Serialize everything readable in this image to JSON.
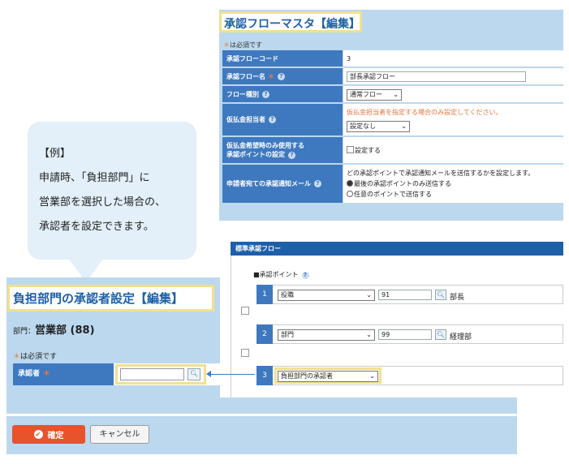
{
  "master": {
    "title": "承認フローマスタ【編集】",
    "required_note": "は必須です",
    "required_mark": "＊",
    "rows": {
      "code": {
        "label": "承認フローコード",
        "value": "3"
      },
      "name": {
        "label": "承認フロー名",
        "value": "部長承認フロー"
      },
      "type": {
        "label": "フロー種別",
        "value": "通常フロー"
      },
      "advance": {
        "label": "仮払金担当者",
        "note": "仮払金担当者を指定する場合のみ設定してください。",
        "value": "設定なし"
      },
      "advance_only": {
        "label_line1": "仮払金希望時のみ使用する",
        "label_line2": "承認ポイントの設定",
        "checkbox_label": "設定する"
      },
      "mail": {
        "label": "申請者宛ての承認通知メール",
        "desc": "どの承認ポイントで承認通知メールを送信するかを設定します。",
        "option1": "最後の承認ポイントのみ送信する",
        "option2": "任意のポイントで送信する"
      }
    }
  },
  "flow": {
    "header": "標準承認フロー",
    "approval_point_label": "■承認ポイント",
    "steps": [
      {
        "num": "1",
        "type": "役職",
        "code": "91",
        "name": "部長"
      },
      {
        "num": "2",
        "type": "部門",
        "code": "99",
        "name": "経理部"
      },
      {
        "num": "3",
        "type": "負担部門の承認者"
      }
    ]
  },
  "bubble": {
    "line1": "【例】",
    "line2": "申請時、「負担部門」に",
    "line3": "営業部を選択した場合の、",
    "line4": "承認者を設定できます。"
  },
  "burden": {
    "title": "負担部門の承認者設定【編集】",
    "dept_label": "部門：",
    "dept_value": "営業部 (88)",
    "required_mark": "＊",
    "required_note": "は必須です",
    "approver_label": "承認者",
    "approver_value": ""
  },
  "buttons": {
    "confirm": "確定",
    "cancel": "キャンセル"
  },
  "icons": {
    "search": "search-icon",
    "help": "help-icon",
    "check": "check-circle-icon"
  },
  "colors": {
    "accent": "#1d5fa8",
    "label_bg": "#3e79c0",
    "panel_bg": "#bcd8ee",
    "highlight": "#f2e08f",
    "confirm": "#e8522c",
    "required": "#e8743b"
  }
}
